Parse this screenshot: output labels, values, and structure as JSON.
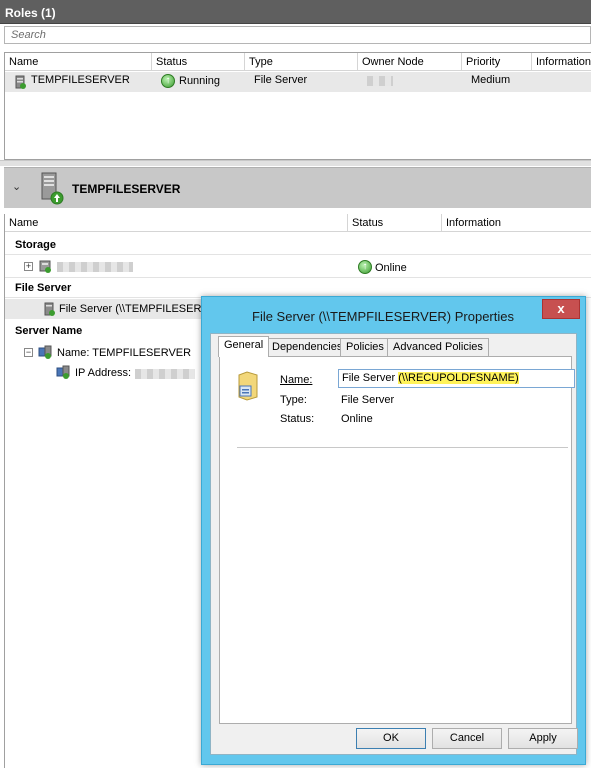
{
  "roles": {
    "header_title": "Roles (1)",
    "search_placeholder": "Search",
    "columns": [
      "Name",
      "Status",
      "Type",
      "Owner Node",
      "Priority",
      "Information"
    ],
    "row": {
      "name": "TEMPFILESERVER",
      "status": "Running",
      "type": "File Server",
      "owner_node": "",
      "priority": "Medium",
      "information": ""
    }
  },
  "detail": {
    "title": "TEMPFILESERVER",
    "columns": [
      "Name",
      "Status",
      "Information"
    ],
    "storage_label": "Storage",
    "storage_status": "Online",
    "file_server_label": "File Server",
    "file_server_item": "File Server (\\\\TEMPFILESERVE",
    "server_name_label": "Server Name",
    "server_name_item": "Name: TEMPFILESERVER",
    "ip_address_label": "IP Address:"
  },
  "dialog": {
    "title": "File Server (\\\\TEMPFILESERVER) Properties",
    "close_symbol": "x",
    "tabs": [
      "General",
      "Dependencies",
      "Policies",
      "Advanced Policies"
    ],
    "name_label": "Name:",
    "name_value_prefix": "File Server ",
    "name_value_highlight": "(\\\\RECUPOLDFSNAME)",
    "type_label": "Type:",
    "type_value": "File Server",
    "status_label": "Status:",
    "status_value": "Online",
    "buttons": {
      "ok": "OK",
      "cancel": "Cancel",
      "apply": "Apply"
    }
  },
  "colors": {
    "dialog_frame": "#62c7ed",
    "close_button": "#c75050",
    "highlight": "#fff35a"
  }
}
